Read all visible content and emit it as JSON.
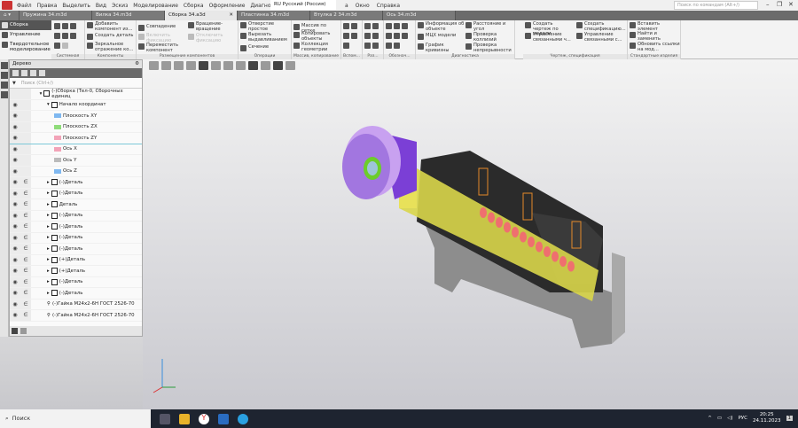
{
  "menu": {
    "items": [
      "Файл",
      "Правка",
      "Выделить",
      "Вид",
      "Эскиз",
      "Моделирование",
      "Сборка",
      "Оформление",
      "Диагностика",
      "Управле"
    ],
    "right_items": [
      "а",
      "Окно",
      "Справка"
    ],
    "language": "RU Русский (Россия)",
    "search_placeholder": "Поиск по командам (Alt+/)"
  },
  "tabs": [
    {
      "label": "Пружина 34.m3d"
    },
    {
      "label": "Вилка 34.m3d"
    },
    {
      "label": "Сборка 34.a3d",
      "active": true
    },
    {
      "label": "Пластинка 34.m3d"
    },
    {
      "label": "Втулка 2 34.m3d"
    },
    {
      "label": "Ось 34.m3d"
    }
  ],
  "ribbon": {
    "modes": [
      "Сборка",
      "Управление",
      "Твердотельное моделирование"
    ],
    "groups": {
      "system": "Системная",
      "components": "Компоненты",
      "placement": "Размещение компонентов",
      "operations": "Операции",
      "array": "Массив, копирование",
      "aux": "Вспом...",
      "dims": "Раз...",
      "marks": "Обознач...",
      "diagnostics": "Диагностика",
      "drawing": "Чертеж, спецификация",
      "standard": "Стандартные изделия"
    },
    "items": {
      "add_component": "Добавить компонент из...",
      "create_part": "Создать деталь",
      "mirror": "Зеркальное отражение ко...",
      "coincidence": "Совпадение",
      "enable_fix": "Включить фиксацию",
      "move_component": "Переместить компонент",
      "rotation": "Вращение-вращение",
      "disable_fix": "Отключить фиксацию",
      "hole": "Отверстие простое",
      "cut_extrude": "Вырезать выдавливанием",
      "section": "Сечение",
      "grid_array": "Массив по сетке",
      "copy_objects": "Копировать объекты",
      "geometry_collection": "Коллекция геометрии",
      "object_info": "Информация об объекте",
      "mass_props": "МЦХ модели",
      "curvature": "График кривизны",
      "distance": "Расстояние и угол",
      "collisions": "Проверка коллизий",
      "continuity": "Проверка непрерывности",
      "create_drawing": "Создать чертеж по модели",
      "manage_linked_drawings": "Управление связанными ч...",
      "create_spec": "Создать спецификацию...",
      "manage_linked_specs": "Управление связанными с...",
      "insert_element": "Вставить элемент",
      "find_replace": "Найти и заменить",
      "update_links": "Обновить ссылки на мод..."
    }
  },
  "tree": {
    "title": "Дерево",
    "search_placeholder": "Поиск (Ctrl+/)",
    "rows": [
      {
        "label": "(-)Сборка (Тел-0, Сборочных единиц",
        "level": 0,
        "eye": false,
        "incl": false,
        "arrow": "▾"
      },
      {
        "label": "Начало координат",
        "level": 1,
        "eye": true,
        "incl": false,
        "arrow": "▾"
      },
      {
        "label": "Плоскость XY",
        "level": 2,
        "eye": true,
        "incl": false,
        "arrow": ""
      },
      {
        "label": "Плоскость ZX",
        "level": 2,
        "eye": true,
        "incl": false,
        "arrow": ""
      },
      {
        "label": "Плоскость ZY",
        "level": 2,
        "eye": true,
        "incl": false,
        "arrow": ""
      },
      {
        "label": "Ось X",
        "level": 2,
        "eye": true,
        "incl": false,
        "arrow": ""
      },
      {
        "label": "Ось Y",
        "level": 2,
        "eye": true,
        "incl": false,
        "arrow": ""
      },
      {
        "label": "Ось Z",
        "level": 2,
        "eye": true,
        "incl": false,
        "arrow": ""
      },
      {
        "label": "(-)Деталь",
        "level": 1,
        "eye": true,
        "incl": true,
        "arrow": "▸"
      },
      {
        "label": "(-)Деталь",
        "level": 1,
        "eye": true,
        "incl": true,
        "arrow": "▸"
      },
      {
        "label": "Деталь",
        "level": 1,
        "eye": true,
        "incl": true,
        "arrow": "▸"
      },
      {
        "label": "(-)Деталь",
        "level": 1,
        "eye": true,
        "incl": true,
        "arrow": "▸"
      },
      {
        "label": "(-)Деталь",
        "level": 1,
        "eye": true,
        "incl": true,
        "arrow": "▸"
      },
      {
        "label": "(-)Деталь",
        "level": 1,
        "eye": true,
        "incl": true,
        "arrow": "▸"
      },
      {
        "label": "(-)Деталь",
        "level": 1,
        "eye": true,
        "incl": true,
        "arrow": "▸"
      },
      {
        "label": "(+)Деталь",
        "level": 1,
        "eye": true,
        "incl": true,
        "arrow": "▸"
      },
      {
        "label": "(+)Деталь",
        "level": 1,
        "eye": true,
        "incl": true,
        "arrow": "▸"
      },
      {
        "label": "(-)Деталь",
        "level": 1,
        "eye": true,
        "incl": true,
        "arrow": "▸"
      },
      {
        "label": "(-)Деталь",
        "level": 1,
        "eye": true,
        "incl": true,
        "arrow": "▸"
      },
      {
        "label": "(-)Гайка М24х2-6Н ГОСТ 2526-70",
        "level": 1,
        "eye": true,
        "incl": true,
        "arrow": ""
      },
      {
        "label": "(-)Гайка М24х2-6Н ГОСТ 2526-70",
        "level": 1,
        "eye": true,
        "incl": true,
        "arrow": ""
      }
    ]
  },
  "taskbar": {
    "search": "Поиск",
    "lang": "РУС",
    "time": "20:25",
    "date": "24.11.2023",
    "notifications": "1"
  },
  "colors": {
    "accent": "#555555",
    "taskbar": "#1e2430",
    "viewport_top": "#f3f3f3",
    "viewport_bottom": "#c9c9cf"
  }
}
